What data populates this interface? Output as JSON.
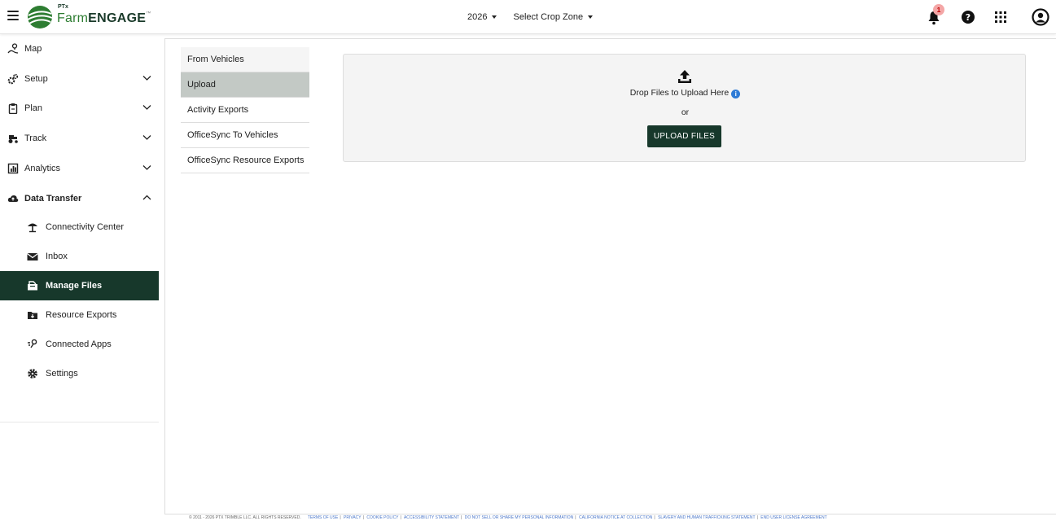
{
  "header": {
    "logo_ptx": "PTx",
    "logo_farm": "Farm",
    "logo_engage": "ENGAGE",
    "logo_tm": "™",
    "year": "2026",
    "crop_zone": "Select Crop Zone",
    "notification_count": "1"
  },
  "sidebar": {
    "items": [
      {
        "label": "Map",
        "icon": "map-pin-icon"
      },
      {
        "label": "Setup",
        "icon": "gears-icon"
      },
      {
        "label": "Plan",
        "icon": "clipboard-icon"
      },
      {
        "label": "Track",
        "icon": "tractor-icon"
      },
      {
        "label": "Analytics",
        "icon": "chart-icon"
      },
      {
        "label": "Data Transfer",
        "icon": "cloud-icon"
      }
    ],
    "sub_items": [
      {
        "label": "Connectivity Center",
        "icon": "tower-icon"
      },
      {
        "label": "Inbox",
        "icon": "envelope-icon"
      },
      {
        "label": "Manage Files",
        "icon": "folder-open-icon"
      },
      {
        "label": "Resource Exports",
        "icon": "folder-download-icon"
      },
      {
        "label": "Connected Apps",
        "icon": "connection-icon"
      },
      {
        "label": "Settings",
        "icon": "gear-icon"
      }
    ]
  },
  "tabs": [
    "From Vehicles",
    "Upload",
    "Activity Exports",
    "OfficeSync To Vehicles",
    "OfficeSync Resource Exports"
  ],
  "dropzone": {
    "drop_text": "Drop Files to Upload Here",
    "or_text": "or",
    "upload_button": "UPLOAD FILES"
  },
  "footer": {
    "copyright": "© 2011 - 2026 PTX TRIMBLE LLC. ALL RIGHTS RESERVED.",
    "links": [
      "TERMS OF USE",
      "PRIVACY",
      "COOKIE POLICY",
      "ACCESSIBILITY STATEMENT",
      "DO NOT SELL OR SHARE MY PERSONAL INFORMATION",
      "CALIFORNIA NOTICE AT COLLECTION",
      "SLAVERY AND HUMAN TRAFFICKING STATEMENT",
      "END USER LICENSE AGREEMENT"
    ]
  },
  "colors": {
    "brand_dark": "#17382b",
    "brand_green": "#2e7d32",
    "active_tab": "#c3c9c5",
    "info_blue": "#2e7bd6"
  }
}
